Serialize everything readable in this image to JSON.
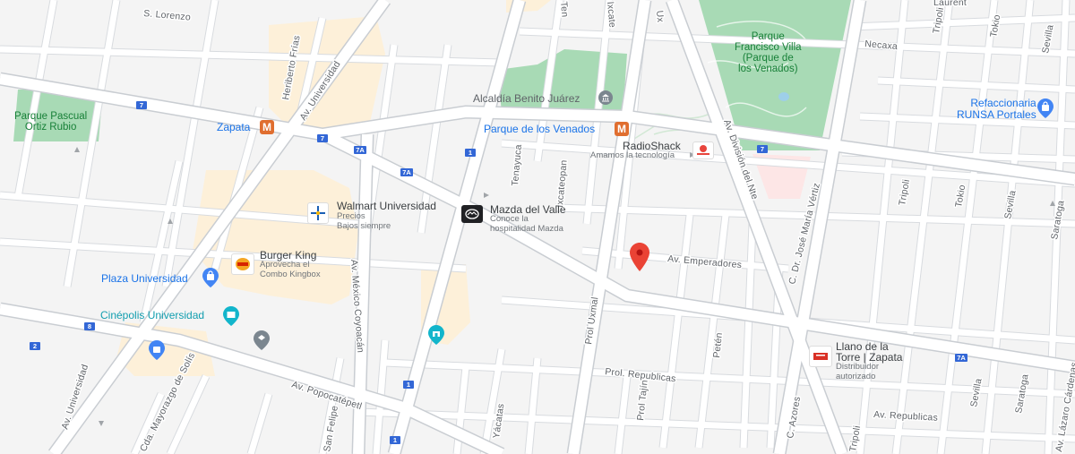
{
  "map": {
    "streets": {
      "s_lorenzo": "S. Lorenzo",
      "heriberto_frias": "Heriberto Frías",
      "av_universidad_top": "Av. Universidad",
      "av_universidad_bottom": "Av. Universidad",
      "necaxa": "Necaxa",
      "tripoli_top": "Tripoli",
      "tripoli_mid": "Tripoli",
      "tripoli_bottom": "Tripoli",
      "tokio_top": "Tokio",
      "tokio_mid": "Tokio",
      "sevilla_top": "Sevilla",
      "sevilla_mid": "Sevilla",
      "sevilla_bottom": "Sevilla",
      "saratoga_mid": "Saratoga",
      "saratoga_bottom": "Saratoga",
      "tenayuca": "Tenayuca",
      "ixcateopan": "Ixcateopan",
      "av_division_del_nte": "Av. División del Nte",
      "c_dr_jose_maria_vertiz": "C. Dr. José María Vértiz",
      "av_emperadores": "Av. Emperadores",
      "av_mexico_coyoacan": "Av. México Coyoacán",
      "prol_uxmal": "Prol Uxmal",
      "prol_republicas": "Prol. Republicas",
      "prol_tajin": "Prol Tajín",
      "peten": "Petén",
      "av_popocatepetl": "Av. Popocatépetl",
      "cda_mayorazgo_de_solis": "Cda. Mayorazgo de Solís",
      "san_felipe": "San Felipe",
      "yacatas": "Yácatas",
      "c_azores": "C. Azores",
      "av_republicas": "Av. Republicas",
      "av_lazaro_cardenas": "Av. Lázaro Cárdenas",
      "laurent": "Laurent",
      "uxmal_top": "Ux",
      "ixcateopan_top": "Ixcate",
      "tenayuca_top": "Ten"
    },
    "shields": {
      "s1": "7",
      "s2": "7",
      "s3": "7A",
      "s4": "7A",
      "s5": "7",
      "s6": "7A",
      "s7": "8",
      "s8": "2",
      "s9": "1",
      "s10": "1",
      "s11": "1"
    },
    "places": {
      "parque_pascual": "Parque Pascual\nOrtiz Rubio",
      "parque_francisco": "Parque\nFrancisco Villa\n(Parque de\nlos Venados)",
      "alcaldia": "Alcaldía Benito Juárez",
      "zapata_metro": "Zapata",
      "parque_venados_metro": "Parque de los Venados",
      "refaccionaria_name": "Refaccionaria\nRUNSA Portales",
      "radioshack_name": "RadioShack",
      "radioshack_sub": "Amamos la tecnología",
      "walmart_name": "Walmart Universidad",
      "walmart_sub": "Precios\nBajos siempre",
      "mazda_name": "Mazda del Valle",
      "mazda_sub": "Conoce la\nhospitalidad Mazda",
      "burger_name": "Burger King",
      "burger_sub": "Aprovecha el\nCombo Kingbox",
      "plaza_universidad": "Plaza Universidad",
      "cinepolis": "Cinépolis Universidad",
      "llano_name": "Llano de la\nTorre | Zapata",
      "llano_sub": "Distribuidor\nautorizado"
    },
    "colors": {
      "background": "#f4f4f4",
      "park": "#a8dab5",
      "commercial": "#fdf0d9",
      "road": "#ffffff",
      "poi_blue": "#1a73e8",
      "pin_red": "#ea4335",
      "metro_orange": "#e06e2f"
    }
  }
}
